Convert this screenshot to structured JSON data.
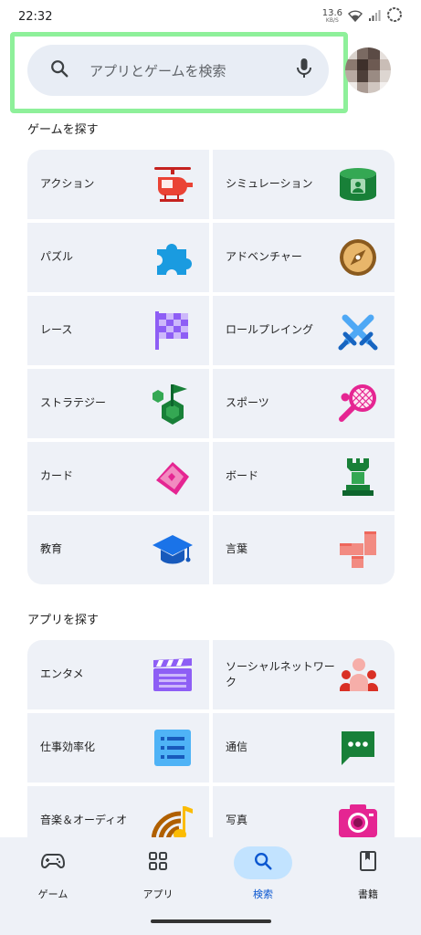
{
  "status_bar": {
    "time": "22:32",
    "net_speed": "13.6",
    "net_unit": "KB/S"
  },
  "search": {
    "placeholder": "アプリとゲームを検索"
  },
  "games_section": {
    "title": "ゲームを探す",
    "categories": [
      {
        "label": "アクション",
        "icon": "helicopter-icon"
      },
      {
        "label": "シミュレーション",
        "icon": "simulation-icon"
      },
      {
        "label": "パズル",
        "icon": "puzzle-icon"
      },
      {
        "label": "アドベンチャー",
        "icon": "compass-icon"
      },
      {
        "label": "レース",
        "icon": "checkered-flag-icon"
      },
      {
        "label": "ロールプレイング",
        "icon": "crossed-swords-icon"
      },
      {
        "label": "ストラテジー",
        "icon": "strategy-flag-icon"
      },
      {
        "label": "スポーツ",
        "icon": "tennis-racket-icon"
      },
      {
        "label": "カード",
        "icon": "cards-icon"
      },
      {
        "label": "ボード",
        "icon": "chess-rook-icon"
      },
      {
        "label": "教育",
        "icon": "graduation-cap-icon"
      },
      {
        "label": "言葉",
        "icon": "word-blocks-icon"
      }
    ]
  },
  "apps_section": {
    "title": "アプリを探す",
    "categories": [
      {
        "label": "エンタメ",
        "icon": "clapperboard-icon"
      },
      {
        "label": "ソーシャルネットワーク",
        "icon": "people-icon"
      },
      {
        "label": "仕事効率化",
        "icon": "checklist-icon"
      },
      {
        "label": "通信",
        "icon": "chat-bubble-icon"
      },
      {
        "label": "音楽＆オーディオ",
        "icon": "music-note-icon"
      },
      {
        "label": "写真",
        "icon": "camera-icon"
      }
    ]
  },
  "bottom_nav": {
    "items": [
      {
        "label": "ゲーム",
        "icon": "gamepad-icon"
      },
      {
        "label": "アプリ",
        "icon": "apps-grid-icon"
      },
      {
        "label": "検索",
        "icon": "search-icon",
        "active": true
      },
      {
        "label": "書籍",
        "icon": "book-icon"
      }
    ]
  },
  "colors": {
    "accent": "#0b57d0",
    "tile_bg": "#eef1f7",
    "search_bg": "#e8edf5",
    "highlight": "#8ef09a"
  }
}
